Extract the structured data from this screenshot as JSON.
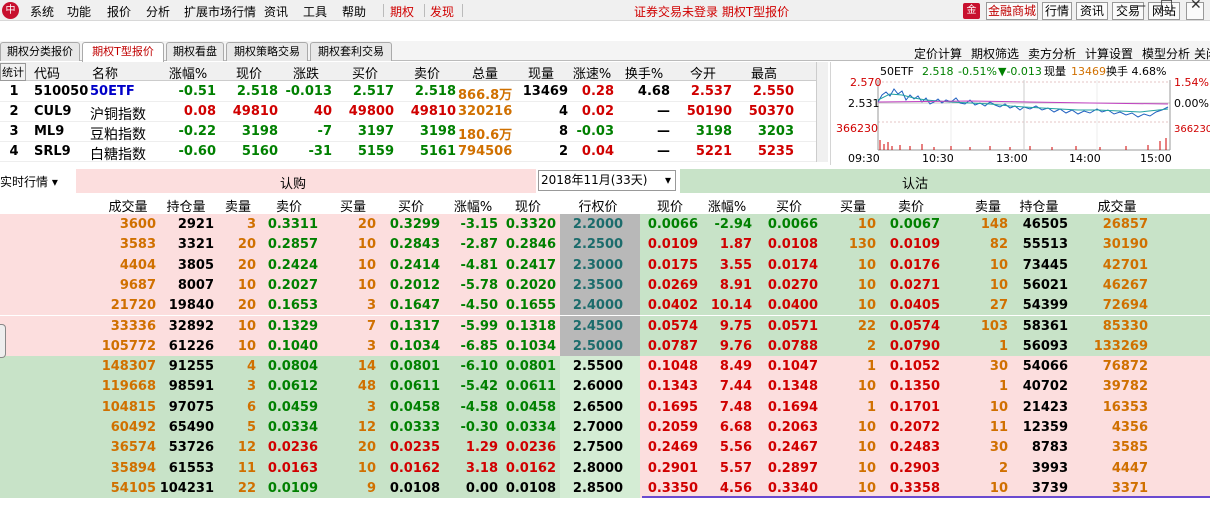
{
  "menubar": {
    "logo": "中",
    "items": [
      "系统",
      "功能",
      "报价",
      "分析",
      "扩展市场行情",
      "资讯",
      "工具",
      "帮助"
    ],
    "red_items": [
      "期权",
      "发现"
    ],
    "status": "证券交易未登录  期权T型报价",
    "mall_icon": "金",
    "mall": "金融商城",
    "buttons": [
      "行情",
      "资讯",
      "交易",
      "网站"
    ],
    "window": [
      "—",
      "□",
      "✕"
    ]
  },
  "tabs": [
    "期权分类报价",
    "期权T型报价",
    "期权看盘",
    "期权策略交易",
    "期权套利交易"
  ],
  "tools": [
    "定价计算",
    "期权筛选",
    "卖方分析",
    "计算设置",
    "模型分析",
    "关闭"
  ],
  "quote": {
    "headers": [
      "统计",
      "代码",
      "名称",
      "涨幅%",
      "现价",
      "涨跌",
      "买价",
      "卖价",
      "总量",
      "现量",
      "涨速%",
      "换手%",
      "今开",
      "最高"
    ],
    "rows": [
      [
        "1",
        "510050",
        "50ETF",
        "-0.51",
        "2.518",
        "-0.013",
        "2.517",
        "2.518",
        "866.8万",
        "13469",
        "0.28",
        "4.68",
        "2.537",
        "2.550"
      ],
      [
        "2",
        "CUL9",
        "沪铜指数",
        "0.08",
        "49810",
        "40",
        "49800",
        "49810",
        "320216",
        "4",
        "0.02",
        "—",
        "50190",
        "50370"
      ],
      [
        "3",
        "ML9",
        "豆粕指数",
        "-0.22",
        "3198",
        "-7",
        "3197",
        "3198",
        "180.6万",
        "8",
        "-0.03",
        "—",
        "3198",
        "3203"
      ],
      [
        "4",
        "SRL9",
        "白糖指数",
        "-0.60",
        "5160",
        "-31",
        "5159",
        "5161",
        "794506",
        "2",
        "0.04",
        "—",
        "5221",
        "5235"
      ]
    ]
  },
  "chart": {
    "header_name": "50ETF",
    "header_price": "2.518",
    "header_pct": "-0.51%",
    "header_chg": "▼-0.013",
    "header_vol_label": "现量",
    "header_vol": "13469",
    "header_turn": "换手 4.68%",
    "y_left": [
      "2.570",
      "2.531",
      "366230"
    ],
    "y_right": [
      "1.54%",
      "0.00%",
      "366230"
    ],
    "x_labels": [
      "09:30",
      "10:30",
      "13:00",
      "14:00",
      "15:00"
    ]
  },
  "tquote": {
    "realtime_label": "实时行情",
    "call_title": "认购",
    "put_title": "认沽",
    "month": "2018年11月(33天)",
    "headers": [
      "成交量",
      "持仓量",
      "卖量",
      "卖价",
      "买量",
      "买价",
      "涨幅%",
      "现价",
      "行权价",
      "现价",
      "涨幅%",
      "买价",
      "买量",
      "卖价",
      "卖量",
      "持仓量",
      "成交量"
    ],
    "rows": [
      [
        "3600",
        "2921",
        "3",
        "0.3311",
        "20",
        "0.3299",
        "-3.15",
        "0.3320",
        "2.2000",
        "0.0066",
        "-2.94",
        "0.0066",
        "10",
        "0.0067",
        "148",
        "46505",
        "26857"
      ],
      [
        "3583",
        "3321",
        "20",
        "0.2857",
        "10",
        "0.2843",
        "-2.87",
        "0.2846",
        "2.2500",
        "0.0109",
        "1.87",
        "0.0108",
        "130",
        "0.0109",
        "82",
        "55513",
        "30190"
      ],
      [
        "4404",
        "3805",
        "20",
        "0.2424",
        "10",
        "0.2414",
        "-4.81",
        "0.2417",
        "2.3000",
        "0.0175",
        "3.55",
        "0.0174",
        "10",
        "0.0176",
        "10",
        "73445",
        "42701"
      ],
      [
        "9687",
        "8007",
        "10",
        "0.2027",
        "10",
        "0.2012",
        "-5.78",
        "0.2020",
        "2.3500",
        "0.0269",
        "8.91",
        "0.0270",
        "10",
        "0.0271",
        "10",
        "56021",
        "46267"
      ],
      [
        "21720",
        "19840",
        "20",
        "0.1653",
        "3",
        "0.1647",
        "-4.50",
        "0.1655",
        "2.4000",
        "0.0402",
        "10.14",
        "0.0400",
        "10",
        "0.0405",
        "27",
        "54399",
        "72694"
      ],
      [
        "33336",
        "32892",
        "10",
        "0.1329",
        "7",
        "0.1317",
        "-5.99",
        "0.1318",
        "2.4500",
        "0.0574",
        "9.75",
        "0.0571",
        "22",
        "0.0574",
        "103",
        "58361",
        "85330"
      ],
      [
        "105772",
        "61226",
        "10",
        "0.1040",
        "3",
        "0.1034",
        "-6.85",
        "0.1034",
        "2.5000",
        "0.0787",
        "9.76",
        "0.0788",
        "2",
        "0.0790",
        "1",
        "56093",
        "133269"
      ],
      [
        "148307",
        "91255",
        "4",
        "0.0804",
        "14",
        "0.0801",
        "-6.10",
        "0.0801",
        "2.5500",
        "0.1048",
        "8.49",
        "0.1047",
        "1",
        "0.1052",
        "30",
        "54066",
        "76872"
      ],
      [
        "119668",
        "98591",
        "3",
        "0.0612",
        "48",
        "0.0611",
        "-5.42",
        "0.0611",
        "2.6000",
        "0.1343",
        "7.44",
        "0.1348",
        "10",
        "0.1350",
        "1",
        "40702",
        "39782"
      ],
      [
        "104815",
        "97075",
        "6",
        "0.0459",
        "3",
        "0.0458",
        "-4.58",
        "0.0458",
        "2.6500",
        "0.1695",
        "7.48",
        "0.1694",
        "1",
        "0.1701",
        "10",
        "21423",
        "16353"
      ],
      [
        "60492",
        "65490",
        "5",
        "0.0334",
        "12",
        "0.0333",
        "-0.30",
        "0.0334",
        "2.7000",
        "0.2059",
        "6.68",
        "0.2063",
        "10",
        "0.2072",
        "11",
        "12359",
        "4356"
      ],
      [
        "36574",
        "53726",
        "12",
        "0.0236",
        "20",
        "0.0235",
        "1.29",
        "0.0236",
        "2.7500",
        "0.2469",
        "5.56",
        "0.2467",
        "10",
        "0.2483",
        "30",
        "8783",
        "3585"
      ],
      [
        "35894",
        "61553",
        "11",
        "0.0163",
        "10",
        "0.0162",
        "3.18",
        "0.0162",
        "2.8000",
        "0.2901",
        "5.57",
        "0.2897",
        "10",
        "0.2903",
        "2",
        "3993",
        "4447"
      ],
      [
        "54105",
        "104231",
        "22",
        "0.0109",
        "9",
        "0.0108",
        "0.00",
        "0.0108",
        "2.8500",
        "0.3350",
        "4.56",
        "0.3340",
        "10",
        "0.3358",
        "10",
        "3739",
        "3371"
      ]
    ]
  },
  "colors": {
    "call_itm": "#fcdede",
    "call_otm": "#c8e3c8",
    "put_itm": "#c8e3c8",
    "put_otm": "#fcdede",
    "strike_itm": "#b8b8b8",
    "strike_otm": "#d4ecd4",
    "up": "#d00000",
    "down": "#008000",
    "volume": "#d07000"
  }
}
